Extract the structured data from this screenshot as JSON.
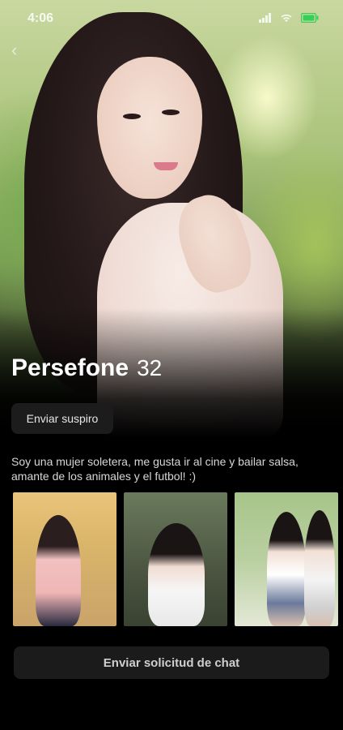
{
  "status_bar": {
    "time": "4:06",
    "icons": [
      "signal-icon",
      "wifi-icon",
      "battery-icon"
    ],
    "battery_color": "#35d05a"
  },
  "profile": {
    "name": "Persefone",
    "age": "32",
    "bio": "Soy una mujer soletera, me gusta ir al cine y bailar salsa, amante de los animales y el futbol! :)"
  },
  "actions": {
    "send_sigh_label": "Enviar suspiro",
    "send_chat_request_label": "Enviar solicitud de chat"
  },
  "colors": {
    "background": "#000000",
    "button_bg": "#1c1c1c",
    "text_primary": "#ffffff",
    "text_secondary": "#d7d7d7"
  }
}
